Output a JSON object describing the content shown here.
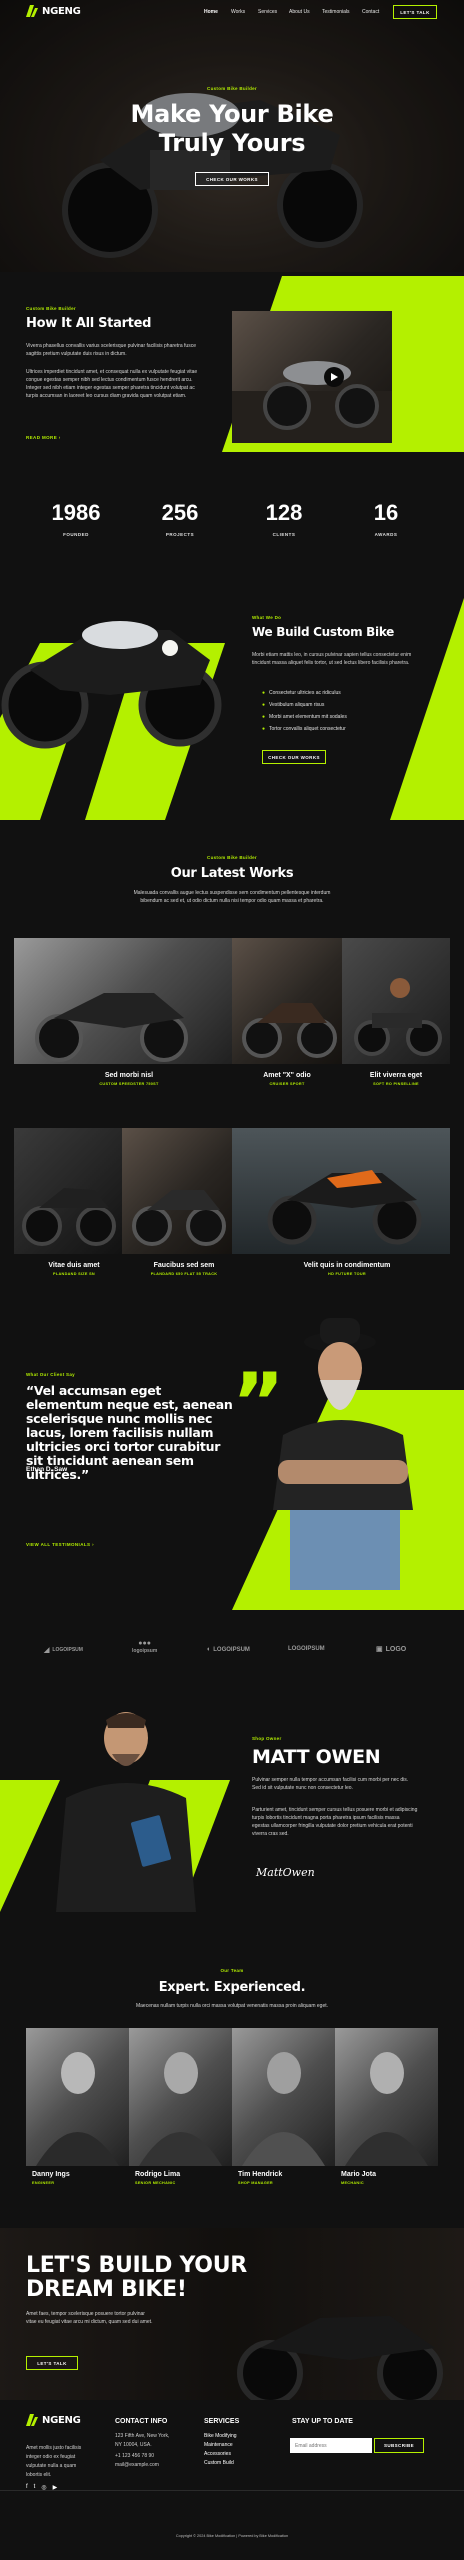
{
  "brand": {
    "name": "NGENG"
  },
  "nav": {
    "items": [
      "Home",
      "Works",
      "Services",
      "About Us",
      "Testimonials",
      "Contact"
    ],
    "cta": "LET'S TALK"
  },
  "hero": {
    "eyebrow": "Custom Bike Builder",
    "title_line1": "Make Your Bike",
    "title_line2": "Truly Yours",
    "button": "CHECK OUR WORKS"
  },
  "about": {
    "eyebrow": "Custom Bike Builder",
    "title": "How It All Started",
    "para1": "Viverra phasellus convallis varius scelerisque pulvinar facilisis pharetra fusce sagittis pretium vulputate duis risus in dictum.",
    "para2": "Ultrices imperdiet tincidunt amet, et consequat nulla ex vulputate feugiat vitae congue egestas semper nibh sed lectus condimentum fusce hendrerit arcu. Integer sed nibh etiam integer egestas semper pharetra tincidunt volutpat ac turpis accumsan in laoreet leo cursus diam gravida quam volutpat etiam.",
    "link": "READ MORE"
  },
  "stats": [
    {
      "number": "1986",
      "label": "FOUNDED"
    },
    {
      "number": "256",
      "label": "PROJECTS"
    },
    {
      "number": "128",
      "label": "CLIENTS"
    },
    {
      "number": "16",
      "label": "AWARDS"
    }
  ],
  "custom": {
    "eyebrow": "What We Do",
    "title": "We Build Custom Bike",
    "para": "Morbi etiam mattis leo, in cursus pulvinar sapien tellus consectetur enim tincidunt massa aliquet felis tortor, ut sed lectus libero facilisis pharetra.",
    "checks": [
      "Consectetur ultricies ac ridiculus",
      "Vestibulum aliquam risus",
      "Morbi amet elementum mit sodales",
      "Tortor convallis aliquet consectetur"
    ],
    "button": "CHECK OUR WORKS"
  },
  "works": {
    "eyebrow": "Custom Bike Builder",
    "title": "Our Latest Works",
    "para": "Malesuada convallis augue lectus suspendisse sem condimentum pellentesque interdum bibendum ac sed et, ut odio dictum nulla nisi tempor odio quam massa et pharetra.",
    "row1": [
      {
        "title": "Sed morbi nisl",
        "category": "CUSTOM SPEEDSTER 750ST"
      },
      {
        "title": "Amet \"X\" odio",
        "category": "CRUISER SPORT"
      },
      {
        "title": "Elit viverra eget",
        "category": "SOFT RO PINSELLINE"
      }
    ],
    "row2": [
      {
        "title": "Vitae duis amet",
        "category": "PLANDAND SIZE SN"
      },
      {
        "title": "Faucibus sed sem",
        "category": "PLANDARD 650 FLAT 55 TRACK"
      },
      {
        "title": "Velit quis in condimentum",
        "category": "HD FUTURE TOUR"
      }
    ]
  },
  "testimonial": {
    "eyebrow": "What Our Client Say",
    "quote": "“Vel accumsan eget elementum neque est, aenean scelerisque nunc mollis nec lacus, lorem facilisis nullam ultricies orci tortor curabitur sit tincidunt aenean sem ultrices.”",
    "author": "Ethan D. Saw",
    "link": "VIEW ALL TESTIMONIALS"
  },
  "logos": [
    "LOGOIPSUM",
    "logoipsum",
    "LOGOIPSUM",
    "LOGOIPSUM",
    "LOGO"
  ],
  "owner": {
    "eyebrow": "Shop Owner",
    "name": "MATT OWEN",
    "para1": "Pulvinar semper nulla tempor accumsan facilisi cum morbi per nec dis. Sed id sit vulputate nunc non consectetur leo.",
    "para2": "Parturient amet, tincidunt semper cursus tellus posuere morbi et adipiscing turpis lobortis tincidunt magna porta pharetra ipsum facilisis massa egestas ullamcorper fringilla vulputate dolor pretium vehicula erat potenti viverra cras sed.",
    "signature": "MattOwen"
  },
  "team": {
    "eyebrow": "Our Team",
    "title": "Expert. Experienced.",
    "para": "Maecenas nullam turpis nulla orci massa volutpat venenatis massa proin aliquam eget.",
    "members": [
      {
        "name": "Danny Ings",
        "role": "ENGINEER"
      },
      {
        "name": "Rodrigo Lima",
        "role": "SENIOR MECHANIC"
      },
      {
        "name": "Tim Hendrick",
        "role": "SHOP MANAGER"
      },
      {
        "name": "Mario Jota",
        "role": "MECHANIC"
      }
    ]
  },
  "cta_section": {
    "title_line1": "LET'S BUILD YOUR",
    "title_line2": "DREAM BIKE!",
    "para": "Amet faes, tempor scelerisque posuere tortor pulvinar vitae eu feugiat vitae arcu mi dictum, quam sed dui amet.",
    "button": "LET'S TALK"
  },
  "footer": {
    "about": "Amet mollis justo facilisis integer odio ex feugiat vulputate nulla a quam lobortis elit.",
    "contact_title": "CONTACT INFO",
    "contact_lines": [
      "123 Fifth Ave, New York, NY 10004, USA.",
      "+1 123 456 78 90",
      "mail@example.com"
    ],
    "services_title": "SERVICES",
    "services": [
      "Bike Modifying",
      "Maintenance",
      "Accessories",
      "Custom Build"
    ],
    "newsletter_title": "STAY UP TO DATE",
    "email_placeholder": "Email address",
    "subscribe": "SUBSCRIBE",
    "copyright": "Copyright © 2024 Bike Modification | Powered by Bike Modification"
  },
  "colors": {
    "accent": "#b4f000",
    "background": "#111111"
  }
}
